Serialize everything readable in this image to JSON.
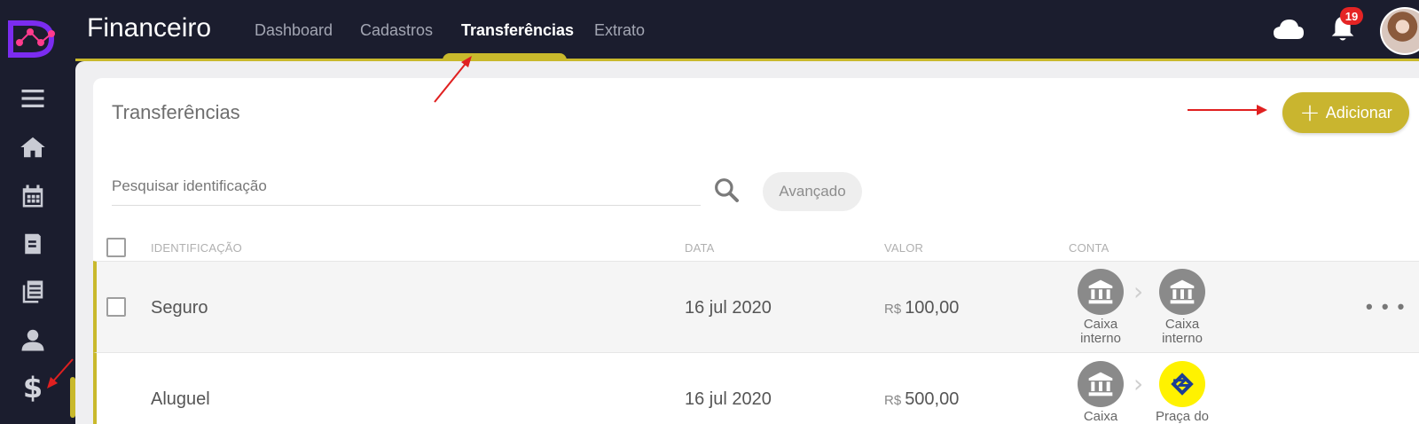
{
  "app": {
    "title": "Financeiro",
    "notifications_count": "19",
    "accent_color": "#c9b92c",
    "nav_bg_color": "#1b1d2e"
  },
  "nav": {
    "items": [
      {
        "label": "Dashboard",
        "icon": "",
        "active": false
      },
      {
        "label": "Cadastros",
        "active": false
      },
      {
        "label": "Transferências",
        "active": true
      },
      {
        "label": "Extrato",
        "active": false
      }
    ]
  },
  "sidebar": {
    "icons": [
      "menu-icon",
      "home-icon",
      "calendar-icon",
      "book-icon",
      "documents-icon",
      "user-icon",
      "dollar-icon"
    ],
    "dollar_symbol": "$"
  },
  "page": {
    "title": "Transferências",
    "add_label": "Adicionar",
    "add_plus": "+",
    "search_placeholder": "Pesquisar identificação",
    "advanced_label": "Avançado"
  },
  "table": {
    "headers": {
      "identificacao": "IDENTIFICAÇÃO",
      "data": "DATA",
      "valor": "VALOR",
      "conta": "CONTA"
    },
    "rows": [
      {
        "identificacao": "Seguro",
        "data": "16 jul 2020",
        "currency": "R$",
        "valor": "100,00",
        "from_label": "Caixa interno",
        "to_label": "Caixa interno",
        "more": "• • •"
      },
      {
        "identificacao": "Aluguel",
        "data": "16 jul 2020",
        "currency": "R$",
        "valor": "500,00",
        "from_label": "Caixa",
        "to_label": "Praça do"
      }
    ]
  }
}
